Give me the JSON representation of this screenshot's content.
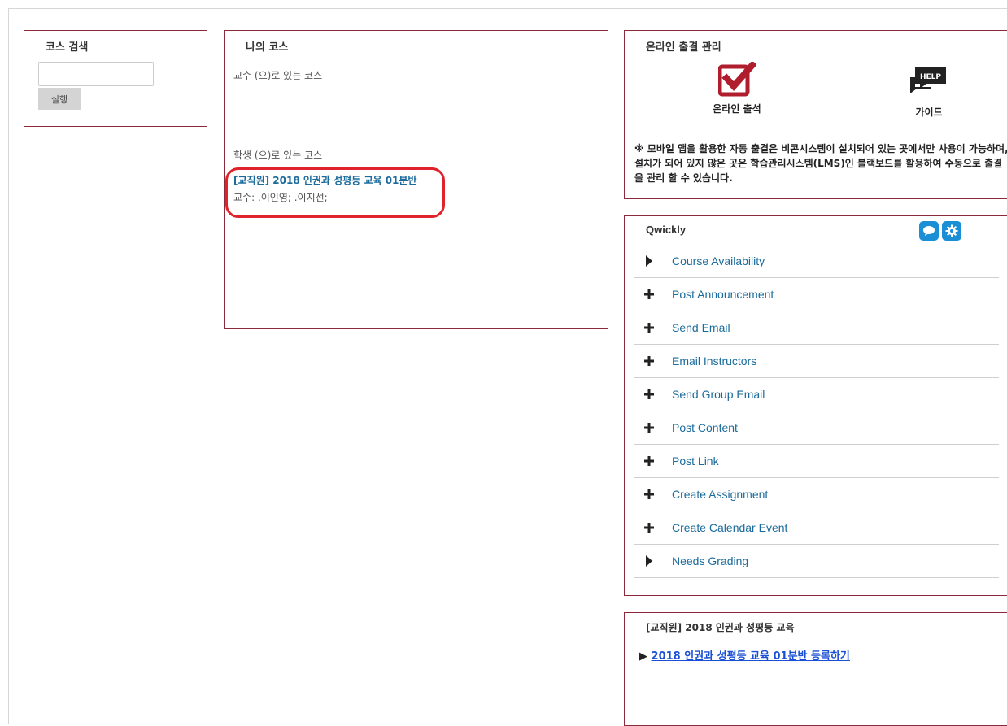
{
  "search": {
    "title": "코스 검색",
    "input_value": "",
    "button_label": "실행"
  },
  "courses": {
    "title": "나의 코스",
    "instructor_role": "교수 (으)로 있는 코스",
    "student_role": "학생 (으)로 있는 코스",
    "course_title": "[교직원] 2018 인권과 성평등 교육 01분반",
    "course_instructors": "교수: .이인영; .이지선;"
  },
  "attendance": {
    "title": "온라인 출결 관리",
    "online_label": "온라인 출석",
    "help_icon_text": "HELP",
    "guide_label": "가이드",
    "note": "※ 모바일 앱을 활용한 자동 출결은 비콘시스템이 설치되어 있는 곳에서만 사용이 가능하며, 설치가 되어 있지 않은 곳은 학습관리시스템(LMS)인 블랙보드를 활용하여 수동으로 출결을 관리 할 수 있습니다."
  },
  "qwickly": {
    "title": "Qwickly",
    "items": [
      {
        "label": "Course Availability",
        "icon": "triangle-right"
      },
      {
        "label": "Post Announcement",
        "icon": "plus"
      },
      {
        "label": "Send Email",
        "icon": "plus"
      },
      {
        "label": "Email Instructors",
        "icon": "plus"
      },
      {
        "label": "Send Group Email",
        "icon": "plus"
      },
      {
        "label": "Post Content",
        "icon": "plus"
      },
      {
        "label": "Post Link",
        "icon": "plus"
      },
      {
        "label": "Create Assignment",
        "icon": "plus"
      },
      {
        "label": "Create Calendar Event",
        "icon": "plus"
      },
      {
        "label": "Needs Grading",
        "icon": "triangle-right"
      }
    ]
  },
  "enroll": {
    "title": "[교직원] 2018 인권과 성평등 교육",
    "bullet": "▶ ",
    "link_label": "2018 인권과 성평등 교육 01분반 등록하기"
  },
  "colors": {
    "panel_border": "#8a2a3a",
    "link": "#1a6b9c",
    "accent_red": "#b01e2e",
    "qwickly_blue": "#1a8fd6",
    "highlight": "#e0222a"
  }
}
